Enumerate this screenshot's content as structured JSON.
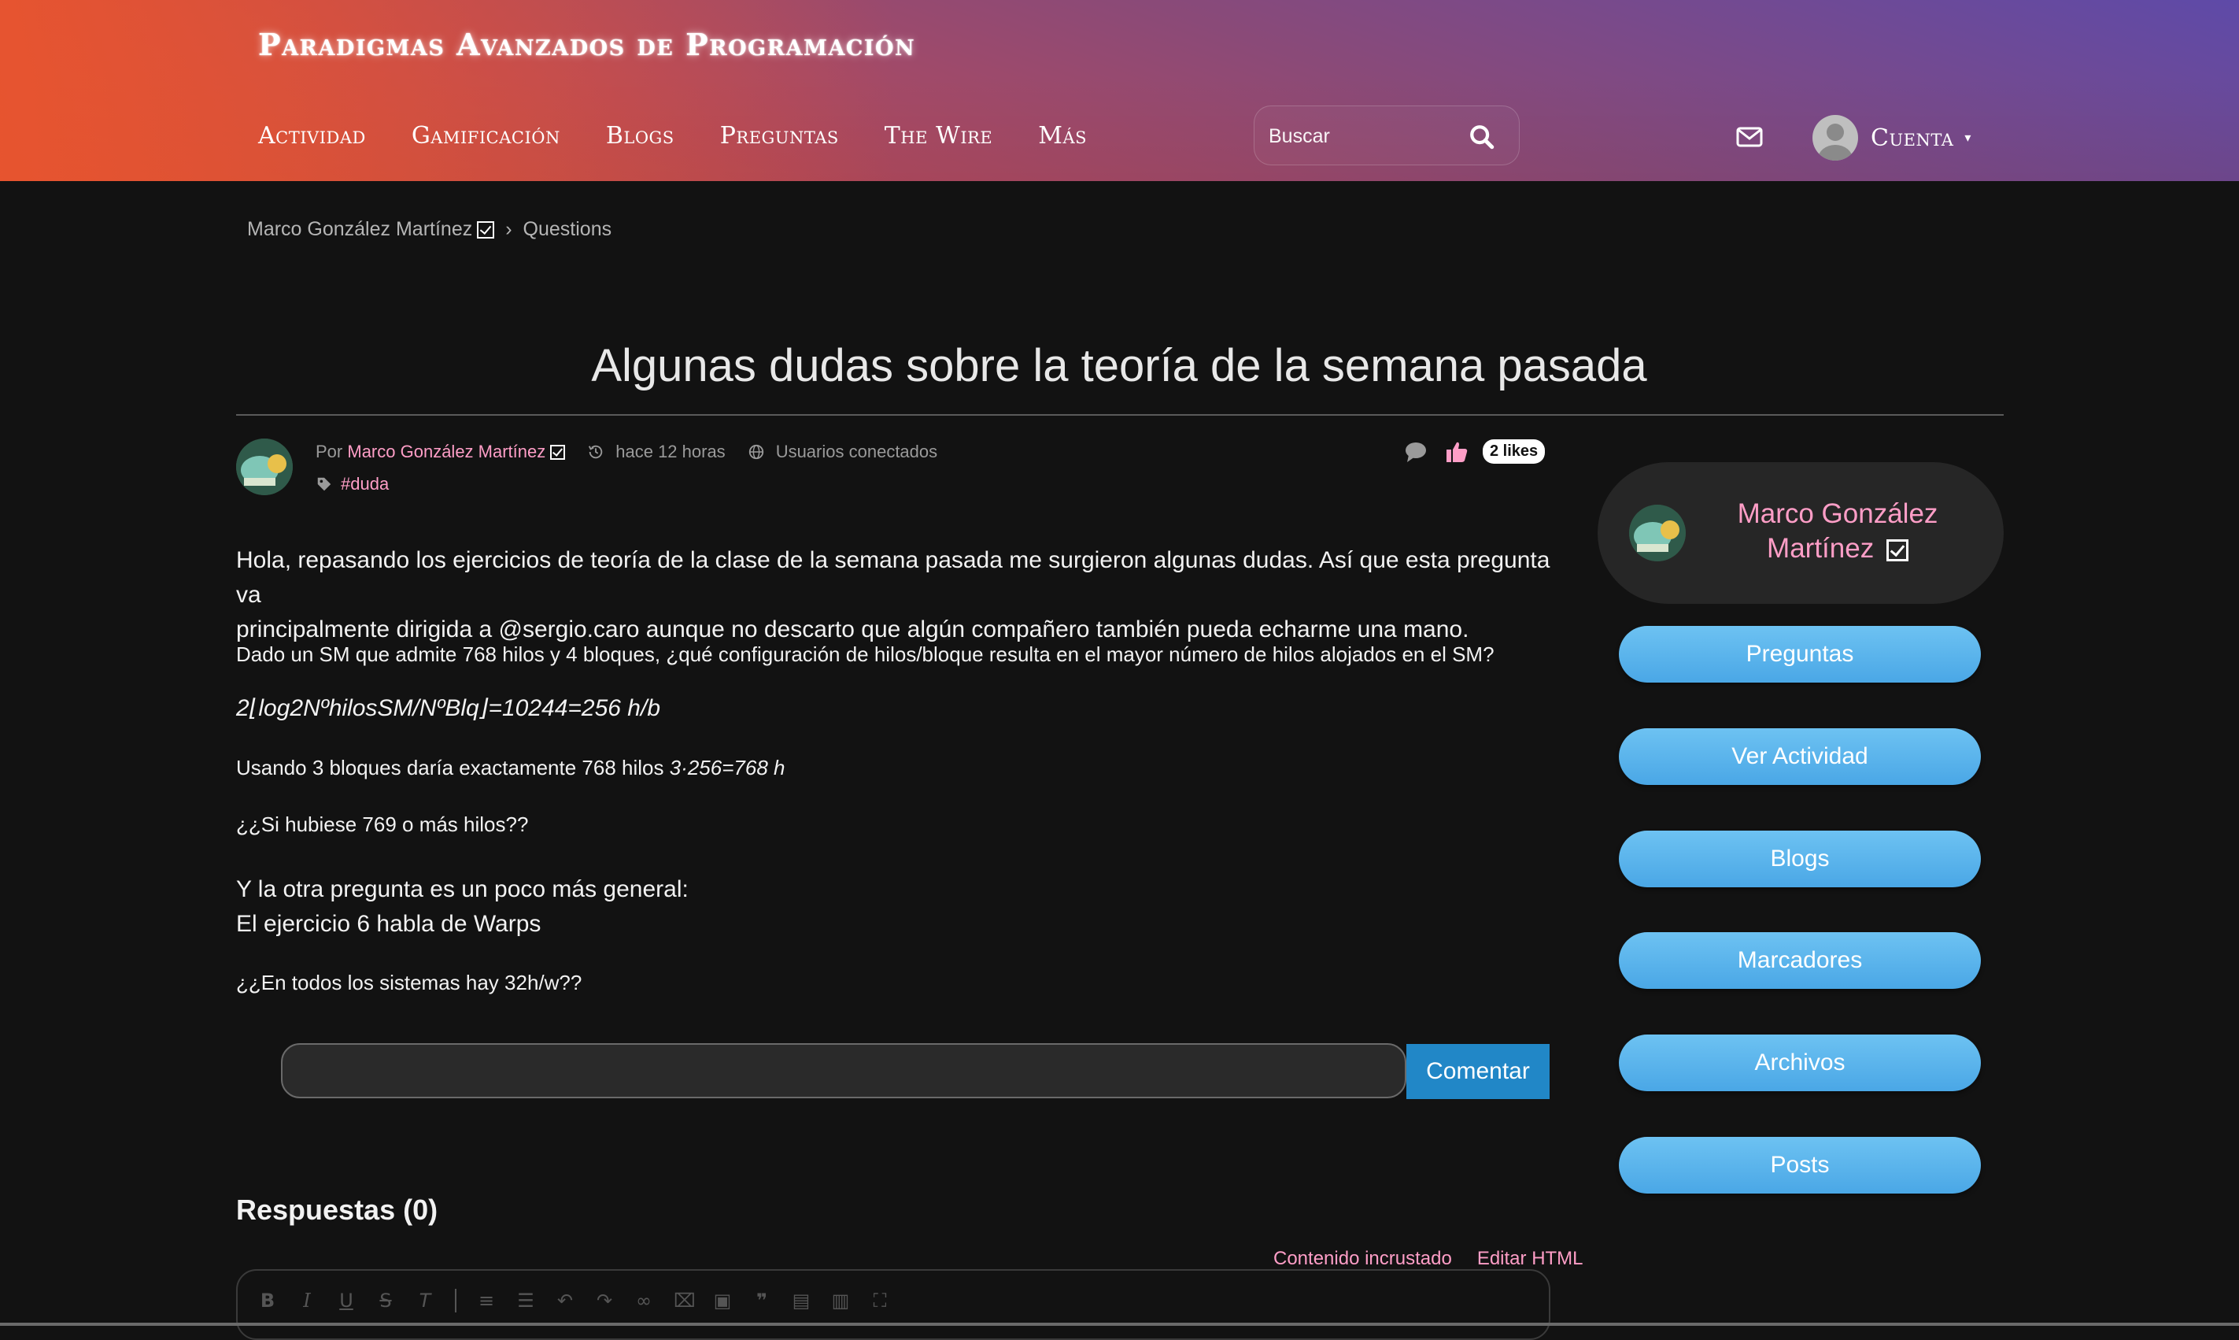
{
  "header": {
    "site_title": "Paradigmas Avanzados de Programación",
    "nav": [
      "Actividad",
      "Gamificación",
      "Blogs",
      "Preguntas",
      "The Wire",
      "Más"
    ],
    "search_placeholder": "Buscar",
    "account_label": "Cuenta"
  },
  "breadcrumb": {
    "author": "Marco González Martínez",
    "separator": "›",
    "section": "Questions"
  },
  "post": {
    "title": "Algunas dudas sobre la teoría de la semana pasada",
    "by_prefix": "Por",
    "author": "Marco González Martínez",
    "time": "hace 12 horas",
    "visibility": "Usuarios conectados",
    "tag": "#duda",
    "likes": "2 likes",
    "paragraph1_line1": "Hola, repasando los ejercicios de teoría de la clase de la semana pasada me surgieron algunas dudas. Así que esta pregunta va",
    "paragraph1_line2": "principalmente dirigida a @sergio.caro aunque no descarto que algún compañero también pueda echarme una mano.",
    "question1": "Dado un SM que admite 768 hilos y 4 bloques, ¿qué configuración de hilos/bloque resulta en el mayor número de hilos alojados en el SM?",
    "formula": "2⌊log2NºhilosSM/NºBlq⌋=10244=256 h/b",
    "usage_text": "Usando 3 bloques daría exactamente 768 hilos",
    "usage_formula": "3·256=768 h",
    "question2": "¿¿Si hubiese 769 o más hilos??",
    "paragraph2_line1": "Y la otra pregunta es un poco más general:",
    "paragraph2_line2": "El ejercicio 6 habla de Warps",
    "question3": "¿¿En todos los sistemas hay 32h/w??"
  },
  "comment": {
    "input_value": "",
    "button_label": "Comentar"
  },
  "answers": {
    "title": "Respuestas (0)",
    "embed_link": "Contenido incrustado",
    "edit_html_link": "Editar HTML",
    "toolbar_icons": [
      "bold-icon",
      "italic-icon",
      "underline-icon",
      "strikethrough-icon",
      "remove-format-icon",
      "numbered-list-icon",
      "bulleted-list-icon",
      "undo-icon",
      "redo-icon",
      "link-icon",
      "unlink-icon",
      "image-icon",
      "blockquote-icon",
      "paste-icon",
      "paste-text-icon",
      "fullscreen-icon"
    ]
  },
  "sidebar": {
    "profile_name_line1": "Marco González",
    "profile_name_line2": "Martínez",
    "buttons": [
      "Preguntas",
      "Ver Actividad",
      "Blogs",
      "Marcadores",
      "Archivos",
      "Posts"
    ]
  },
  "colors": {
    "background": "#121212",
    "accent_pink": "#ff9ec7",
    "button_blue": "#2187c7",
    "sidebar_button": "#5bb6ec"
  }
}
